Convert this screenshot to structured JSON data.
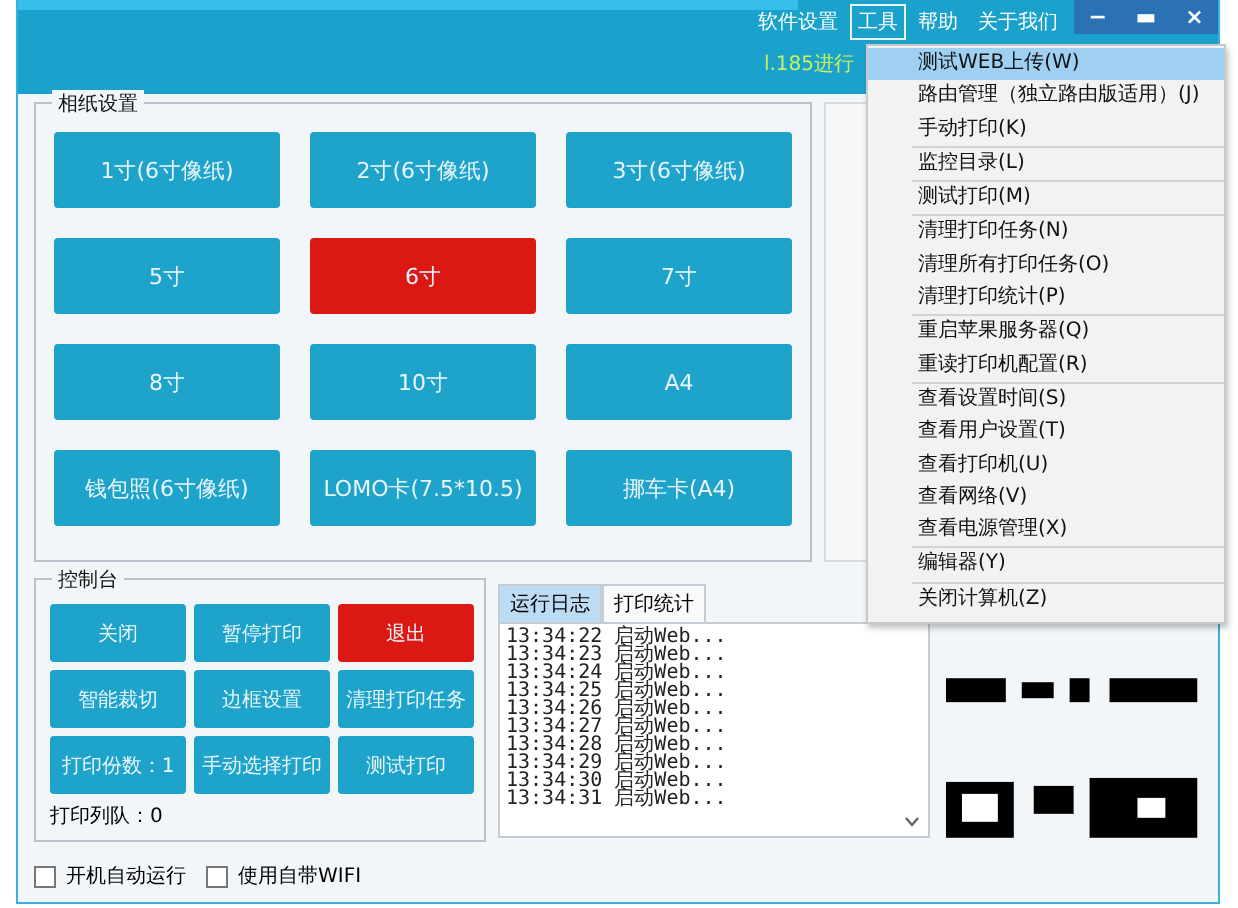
{
  "menu_bar": [
    {
      "label": "软件设置",
      "selected": false
    },
    {
      "label": "工具",
      "selected": true
    },
    {
      "label": "帮助",
      "selected": false
    },
    {
      "label": "关于我们",
      "selected": false
    }
  ],
  "window_controls": [
    "−",
    "▬",
    "×"
  ],
  "status_text": "l.185进行",
  "photo_paper": {
    "title": "相纸设置",
    "buttons": [
      {
        "label": "1寸(6寸像纸)",
        "selected": false
      },
      {
        "label": "2寸(6寸像纸)",
        "selected": false
      },
      {
        "label": "3寸(6寸像纸)",
        "selected": false
      },
      {
        "label": "5寸",
        "selected": false
      },
      {
        "label": "6寸",
        "selected": true
      },
      {
        "label": "7寸",
        "selected": false
      },
      {
        "label": "8寸",
        "selected": false
      },
      {
        "label": "10寸",
        "selected": false
      },
      {
        "label": "A4",
        "selected": false
      },
      {
        "label": "钱包照(6寸像纸)",
        "selected": false
      },
      {
        "label": "LOMO卡(7.5*10.5)",
        "selected": false
      },
      {
        "label": "挪车卡(A4)",
        "selected": false
      }
    ]
  },
  "console": {
    "title": "控制台",
    "buttons": [
      {
        "label": "关闭",
        "kind": "normal"
      },
      {
        "label": "暂停打印",
        "kind": "normal"
      },
      {
        "label": "退出",
        "kind": "danger"
      },
      {
        "label": "智能裁切",
        "kind": "normal"
      },
      {
        "label": "边框设置",
        "kind": "normal"
      },
      {
        "label": "清理打印任务",
        "kind": "normal"
      },
      {
        "label": "打印份数：1",
        "kind": "normal"
      },
      {
        "label": "手动选择打印",
        "kind": "normal"
      },
      {
        "label": "测试打印",
        "kind": "normal"
      }
    ],
    "queue": "打印列队：0"
  },
  "log": {
    "tabs": [
      {
        "label": "运行日志",
        "selected": true
      },
      {
        "label": "打印统计",
        "selected": false
      }
    ],
    "lines": [
      "13:34:22 启动Web...",
      "13:34:23 启动Web...",
      "13:34:24 启动Web...",
      "13:34:25 启动Web...",
      "13:34:26 启动Web...",
      "13:34:27 启动Web...",
      "13:34:28 启动Web...",
      "13:34:29 启动Web...",
      "13:34:30 启动Web...",
      "13:34:31 启动Web..."
    ]
  },
  "options": [
    {
      "label": "开机自动运行",
      "checked": false
    },
    {
      "label": "使用自带WIFI",
      "checked": false
    }
  ],
  "tools_menu": {
    "groups": [
      [
        {
          "label": "测试WEB上传(W)",
          "selected": true
        },
        {
          "label": "路由管理（独立路由版适用）(J)",
          "selected": false
        },
        {
          "label": "手动打印(K)",
          "selected": false
        }
      ],
      [
        {
          "label": "监控目录(L)",
          "selected": false
        }
      ],
      [
        {
          "label": "测试打印(M)",
          "selected": false
        }
      ],
      [
        {
          "label": "清理打印任务(N)",
          "selected": false
        },
        {
          "label": "清理所有打印任务(O)",
          "selected": false
        },
        {
          "label": "清理打印统计(P)",
          "selected": false
        }
      ],
      [
        {
          "label": "重启苹果服务器(Q)",
          "selected": false
        },
        {
          "label": "重读打印机配置(R)",
          "selected": false
        }
      ],
      [
        {
          "label": "查看设置时间(S)",
          "selected": false
        },
        {
          "label": "查看用户设置(T)",
          "selected": false
        },
        {
          "label": "查看打印机(U)",
          "selected": false
        },
        {
          "label": "查看网络(V)",
          "selected": false
        },
        {
          "label": "查看电源管理(X)",
          "selected": false
        }
      ],
      [
        {
          "label": "编辑器(Y)",
          "selected": false
        }
      ],
      [
        {
          "label": "关闭计算机(Z)",
          "selected": false
        }
      ]
    ]
  }
}
